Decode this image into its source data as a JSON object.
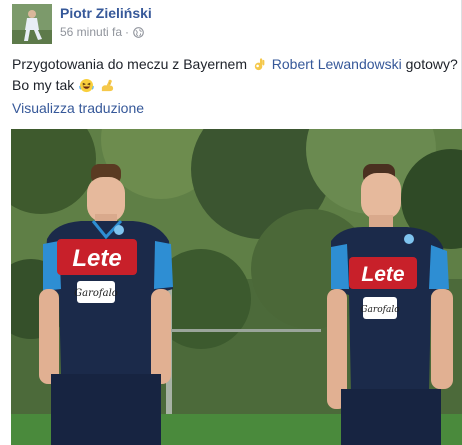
{
  "post": {
    "author": "Piotr Zieliński",
    "time": "56 minuti fa",
    "separator": "·",
    "privacy_icon": "globe-icon",
    "text": {
      "part1": "Przygotowania do meczu z Bayernem",
      "mention": "Robert Lewandowski",
      "part2": "gotowy?",
      "line2": "Bo my tak"
    },
    "emojis": [
      "ok-hand-emoji",
      "laughing-emoji",
      "flexed-biceps-emoji"
    ],
    "translate_label": "Visualizza traduzione"
  },
  "photo": {
    "sponsor_left": "Lete",
    "sponsor_right": "Lete",
    "secondary_sponsor": "Garofalo"
  },
  "colors": {
    "link": "#365899",
    "meta": "#90949c",
    "text": "#1d2129",
    "jersey": "#1b2a4a",
    "sponsor_red": "#c8202a"
  }
}
